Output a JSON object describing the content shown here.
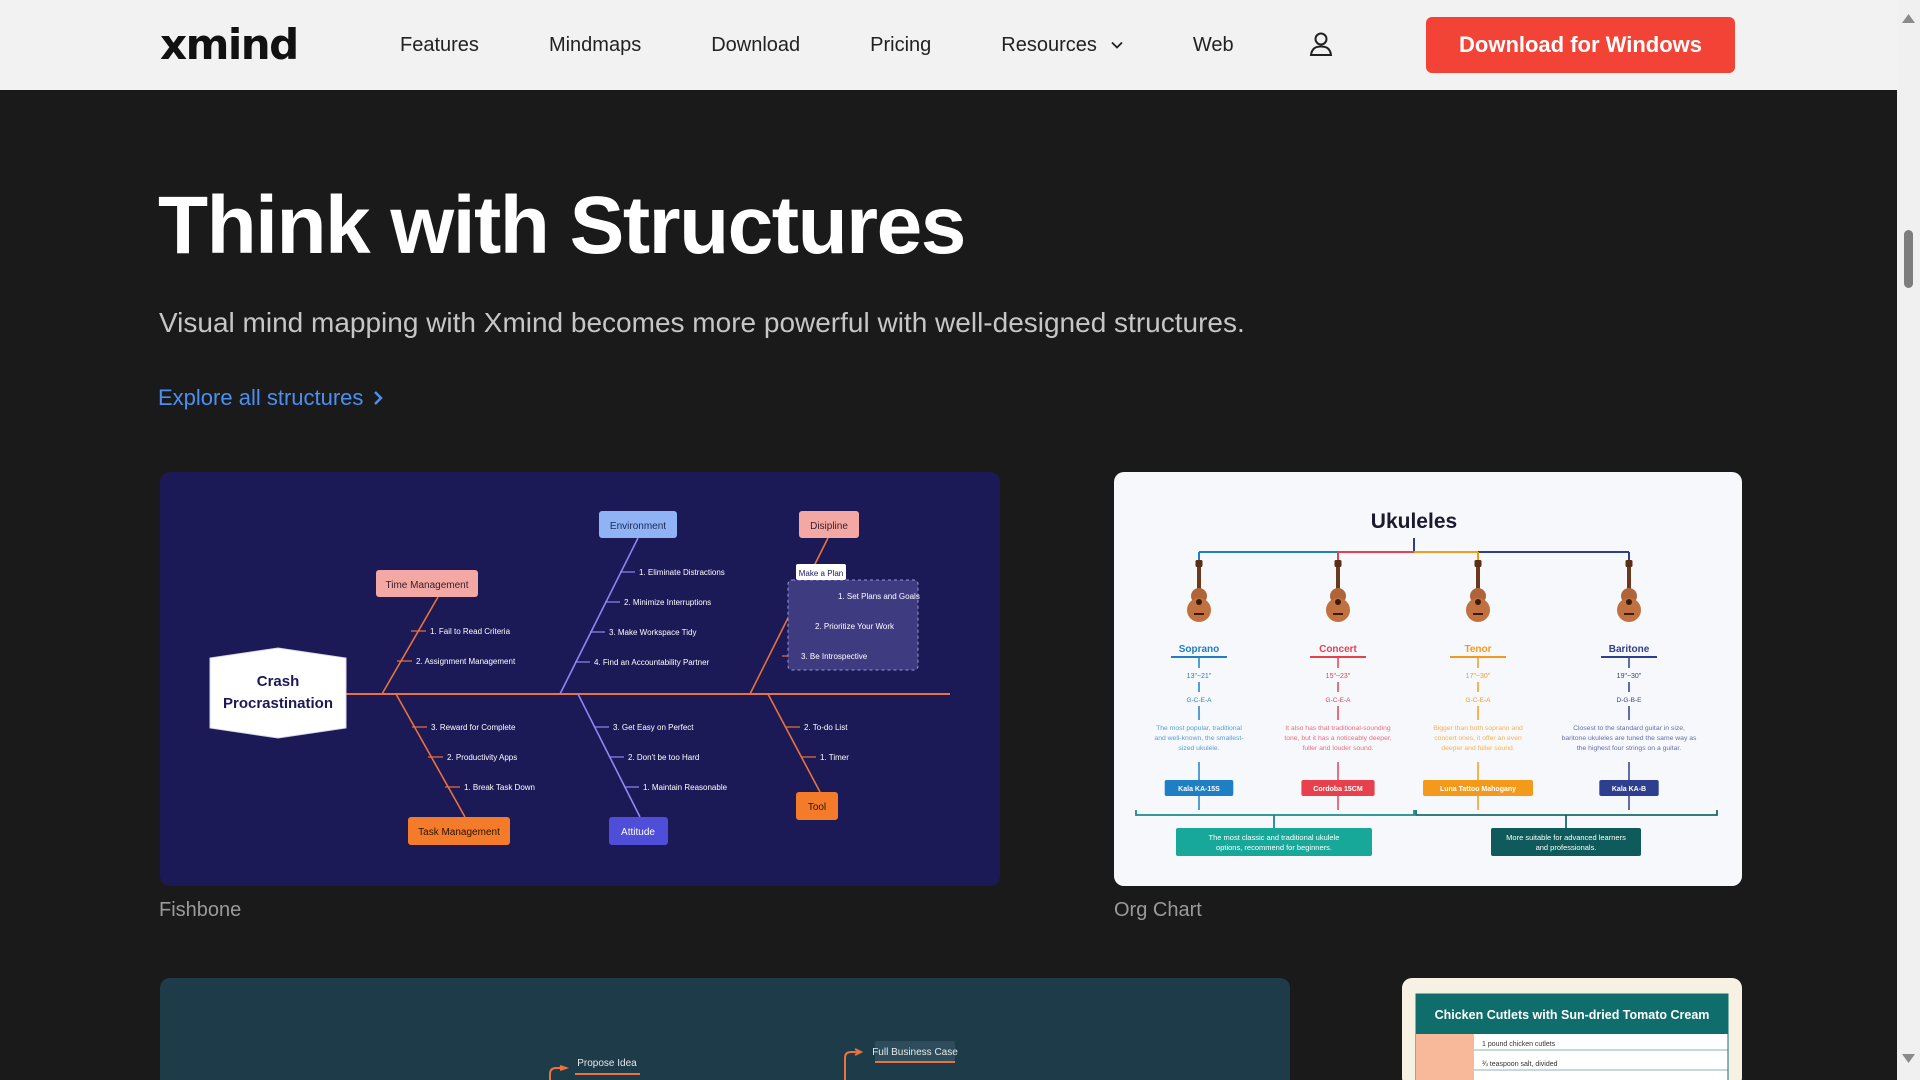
{
  "nav": {
    "logo": "xmind",
    "links": [
      "Features",
      "Mindmaps",
      "Download",
      "Pricing",
      "Resources",
      "Web"
    ],
    "cta": "Download for Windows"
  },
  "hero": {
    "title": "Think with Structures",
    "subtitle": "Visual mind mapping with Xmind becomes more powerful with well-designed structures.",
    "explore": "Explore all structures"
  },
  "cards": {
    "fishbone": {
      "caption": "Fishbone",
      "head": [
        "Crash",
        "Procrastination"
      ],
      "categories": {
        "time": "Time Management",
        "environment": "Environment",
        "discipline": "Disipline",
        "task": "Task Management",
        "attitude": "Attitude",
        "tool": "Tool"
      },
      "make_plan": "Make a Plan",
      "items": {
        "time": [
          "1. Fail to Read Criteria",
          "2. Assignment Management"
        ],
        "environment": [
          "1. Eliminate Distractions",
          "2. Minimize Interruptions",
          "3. Make Workspace Tidy",
          "4. Find an Accountability Partner"
        ],
        "discipline": [
          "1. Set Plans and Goals",
          "2. Prioritize Your Work",
          "3. Be Introspective"
        ],
        "task": [
          "3. Reward for Complete",
          "2. Productivity Apps",
          "1. Break Task Down"
        ],
        "attitude": [
          "3. Get Easy on Perfect",
          "2. Don't be too Hard",
          "1. Maintain Reasonable"
        ],
        "tool": [
          "2. To-do List",
          "1. Timer"
        ]
      }
    },
    "orgchart": {
      "caption": "Org Chart",
      "title": "Ukuleles",
      "types": [
        {
          "name": "Soprano",
          "size": "13\"~21\"",
          "tuning": "G-C-E-A",
          "desc": [
            "The most popular, traditional",
            "and well-known, the smallest-",
            "sized ukulele."
          ],
          "model": "Kala KA-15S",
          "color": "#1f7fc4"
        },
        {
          "name": "Concert",
          "size": "15\"~23\"",
          "tuning": "G-C-E-A",
          "desc": [
            "It also has that traditional-sounding",
            "tone, but it has a noticeably deeper,",
            "fuller and louder sound."
          ],
          "model": "Cordoba 15CM",
          "color": "#e8414e"
        },
        {
          "name": "Tenor",
          "size": "17\"~30\"",
          "tuning": "G-C-E-A",
          "desc": [
            "Bigger than both soprano and",
            "concert ones, it offer an even",
            "deeper and fuller sound."
          ],
          "model": "Luna Tattoo Mahogany",
          "color": "#f49a1a"
        },
        {
          "name": "Baritone",
          "size": "19\"~30\"",
          "tuning": "D-G-B-E",
          "desc": [
            "Closest to the standard guitar in size,",
            "baritone ukuleles are tuned the same way as",
            "the highest four strings on a guitar."
          ],
          "model": "Kala KA-B",
          "color": "#2f3f8f"
        }
      ],
      "groups": [
        [
          "The most classic and traditional ukulele",
          "options, recommend for beginners."
        ],
        [
          "More suitable for advanced learners",
          "and professionals."
        ]
      ]
    },
    "tree": {
      "nodes": [
        "Propose Idea",
        "Full Business Case"
      ]
    },
    "recipe": {
      "title": "Chicken Cutlets with Sun-dried Tomato Cream",
      "rows": [
        "1 pound chicken cutlets",
        "¾ teaspoon salt, divided"
      ]
    }
  },
  "colors": {
    "cta": "#f24336",
    "link": "#4b8ff0",
    "page_bg": "#1a1a1a",
    "fishbone_bg": "#1c1957",
    "spine": "#e9733a"
  }
}
